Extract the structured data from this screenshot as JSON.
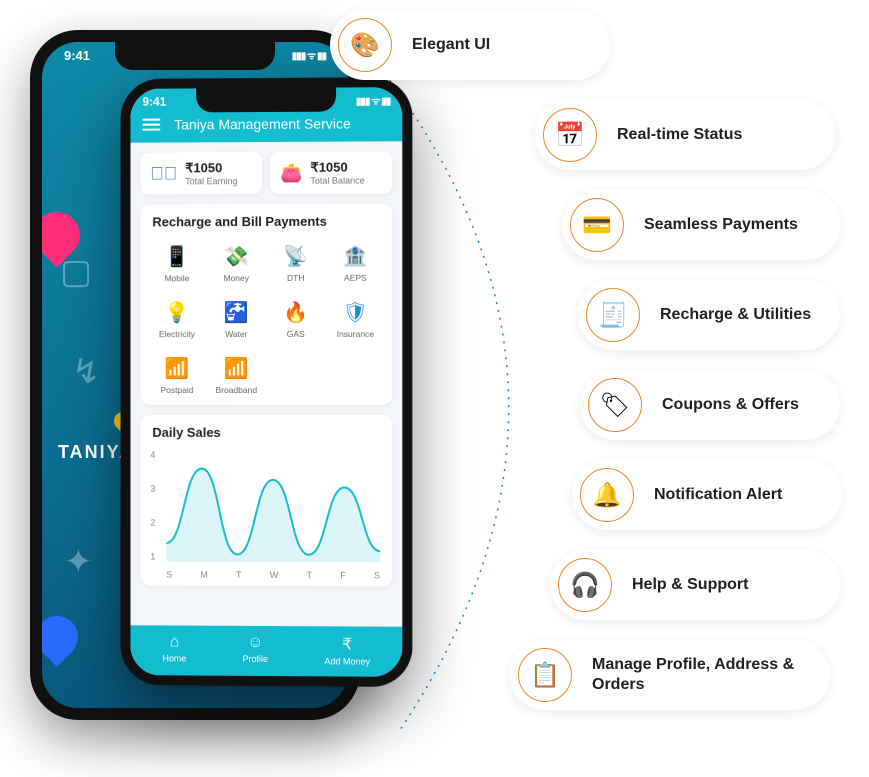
{
  "phone_back": {
    "status_time": "9:41",
    "brand_text": "TANIYA"
  },
  "phone_front": {
    "status_time": "9:41",
    "app_title": "Taniya Management Service",
    "earning": {
      "amount": "₹1050",
      "label": "Total Earning"
    },
    "balance": {
      "amount": "₹1050",
      "label": "Total Balance"
    },
    "recharge_title": "Recharge and Bill Payments",
    "tiles": [
      {
        "icon": "📱",
        "label": "Mobile"
      },
      {
        "icon": "💸",
        "label": "Money"
      },
      {
        "icon": "📡",
        "label": "DTH"
      },
      {
        "icon": "🏦",
        "label": "AEPS"
      },
      {
        "icon": "💡",
        "label": "Electricity"
      },
      {
        "icon": "🚰",
        "label": "Water"
      },
      {
        "icon": "🔥",
        "label": "GAS"
      },
      {
        "icon": "🛡",
        "label": "Insurance"
      },
      {
        "icon": "📶",
        "label": "Postpaid"
      },
      {
        "icon": "📶",
        "label": "Broadband"
      }
    ],
    "chart_title": "Daily Sales",
    "nav": [
      {
        "icon": "⌂",
        "label": "Home"
      },
      {
        "icon": "☺",
        "label": "Profile"
      },
      {
        "icon": "₹",
        "label": "Add Money"
      }
    ]
  },
  "features": [
    {
      "icon": "🎨",
      "label": "Elegant UI"
    },
    {
      "icon": "📅",
      "label": "Real-time Status"
    },
    {
      "icon": "💳",
      "label": "Seamless Payments"
    },
    {
      "icon": "🧾",
      "label": "Recharge & Utilities"
    },
    {
      "icon": "🏷",
      "label": "Coupons & Offers"
    },
    {
      "icon": "🔔",
      "label": "Notification Alert"
    },
    {
      "icon": "🎧",
      "label": "Help & Support"
    },
    {
      "icon": "📋",
      "label": "Manage Profile, Address & Orders"
    }
  ],
  "chart_data": {
    "type": "line",
    "categories": [
      "S",
      "M",
      "T",
      "W",
      "T",
      "F",
      "S"
    ],
    "values": [
      1.5,
      3.5,
      1.2,
      3.2,
      1.2,
      3.0,
      1.3
    ],
    "title": "Daily Sales",
    "xlabel": "",
    "ylabel": "",
    "ylim": [
      1,
      4
    ],
    "y_ticks": [
      1,
      2,
      3,
      4
    ]
  }
}
